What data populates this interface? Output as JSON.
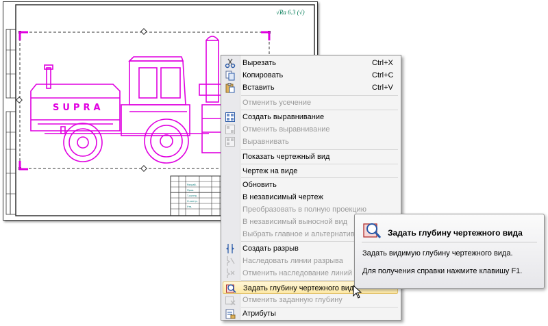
{
  "drawing": {
    "roughness_text": "√Ra 6.3 (√)",
    "model_text": "SUPRA",
    "colors": {
      "selection": "#e000e0",
      "frame": "#333333",
      "note": "#007a55"
    }
  },
  "context_menu": {
    "items": [
      {
        "label": "Вырезать",
        "shortcut": "Ctrl+X",
        "icon": "scissors-icon",
        "enabled": true
      },
      {
        "label": "Копировать",
        "shortcut": "Ctrl+C",
        "icon": "copy-icon",
        "enabled": true
      },
      {
        "label": "Вставить",
        "shortcut": "Ctrl+V",
        "icon": "paste-icon",
        "enabled": true
      },
      {
        "label": "Отменить усечение",
        "shortcut": "",
        "icon": "",
        "enabled": false
      },
      {
        "label": "Создать выравнивание",
        "shortcut": "",
        "icon": "align-icon",
        "enabled": true
      },
      {
        "label": "Отменить выравнивание",
        "shortcut": "",
        "icon": "cancel-align-icon",
        "enabled": false
      },
      {
        "label": "Выравнивать",
        "shortcut": "",
        "icon": "do-align-icon",
        "enabled": false
      },
      {
        "label": "Показать чертежный вид",
        "shortcut": "",
        "icon": "",
        "enabled": true
      },
      {
        "label": "Чертеж на виде",
        "shortcut": "",
        "icon": "",
        "enabled": true
      },
      {
        "label": "Обновить",
        "shortcut": "",
        "icon": "",
        "enabled": true
      },
      {
        "label": "В независимый чертеж",
        "shortcut": "",
        "icon": "",
        "enabled": true
      },
      {
        "label": "Преобразовать в полную проекцию",
        "shortcut": "",
        "icon": "",
        "enabled": false
      },
      {
        "label": "В независимый выносной вид",
        "shortcut": "",
        "icon": "",
        "enabled": false
      },
      {
        "label": "Выбрать главное и альтернативное по",
        "shortcut": "",
        "icon": "",
        "enabled": false
      },
      {
        "label": "Создать разрыв",
        "shortcut": "",
        "icon": "break-icon",
        "enabled": true
      },
      {
        "label": "Наследовать линии разрыва",
        "shortcut": "",
        "icon": "inherit-break-icon",
        "enabled": false
      },
      {
        "label": "Отменить наследование линий разрыв",
        "shortcut": "",
        "icon": "cancel-inherit-icon",
        "enabled": false
      },
      {
        "label": "Задать глубину чертежного вида",
        "shortcut": "",
        "icon": "view-depth-icon",
        "enabled": true,
        "highlighted": true
      },
      {
        "label": "Отменить заданную глубину",
        "shortcut": "",
        "icon": "cancel-depth-icon",
        "enabled": false
      },
      {
        "label": "Атрибуты",
        "shortcut": "",
        "icon": "attributes-icon",
        "enabled": true
      }
    ]
  },
  "tooltip": {
    "title": "Задать глубину чертежного вида",
    "description": "Задать видимую глубину чертежного вида.",
    "help": "Для получения справки нажмите клавишу F1.",
    "icon": "view-depth-icon"
  }
}
